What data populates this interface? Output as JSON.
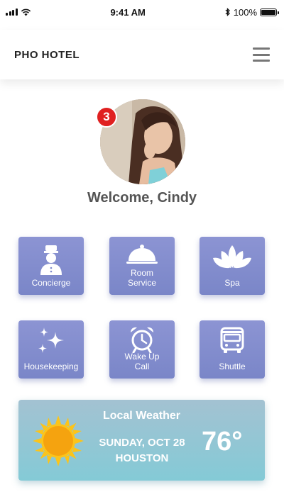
{
  "status_bar": {
    "time": "9:41 AM",
    "battery_percent": "100%",
    "bluetooth_icon": "bluetooth-icon",
    "wifi_icon": "wifi-icon",
    "signal_icon": "signal-icon"
  },
  "header": {
    "title": "PHO HOTEL",
    "menu_icon": "hamburger-menu-icon"
  },
  "profile": {
    "notification_count": "3",
    "welcome": "Welcome, Cindy"
  },
  "services": [
    {
      "label": "Concierge",
      "icon": "bellhop-icon"
    },
    {
      "label": "Room\nService",
      "icon": "cloche-icon"
    },
    {
      "label": "Spa",
      "icon": "lotus-icon"
    },
    {
      "label": "Housekeeping",
      "icon": "sparkles-icon"
    },
    {
      "label": "Wake Up\nCall",
      "icon": "alarm-clock-icon"
    },
    {
      "label": "Shuttle",
      "icon": "bus-icon"
    }
  ],
  "weather": {
    "title": "Local Weather",
    "date": "SUNDAY, OCT 28",
    "city": "HOUSTON",
    "temperature": "76°",
    "icon": "sun-icon"
  },
  "colors": {
    "tile": "#7f8acb",
    "badge": "#e02020",
    "weather_top": "#a3c2d2",
    "weather_bottom": "#84cad6",
    "sun": "#f5a30f"
  }
}
